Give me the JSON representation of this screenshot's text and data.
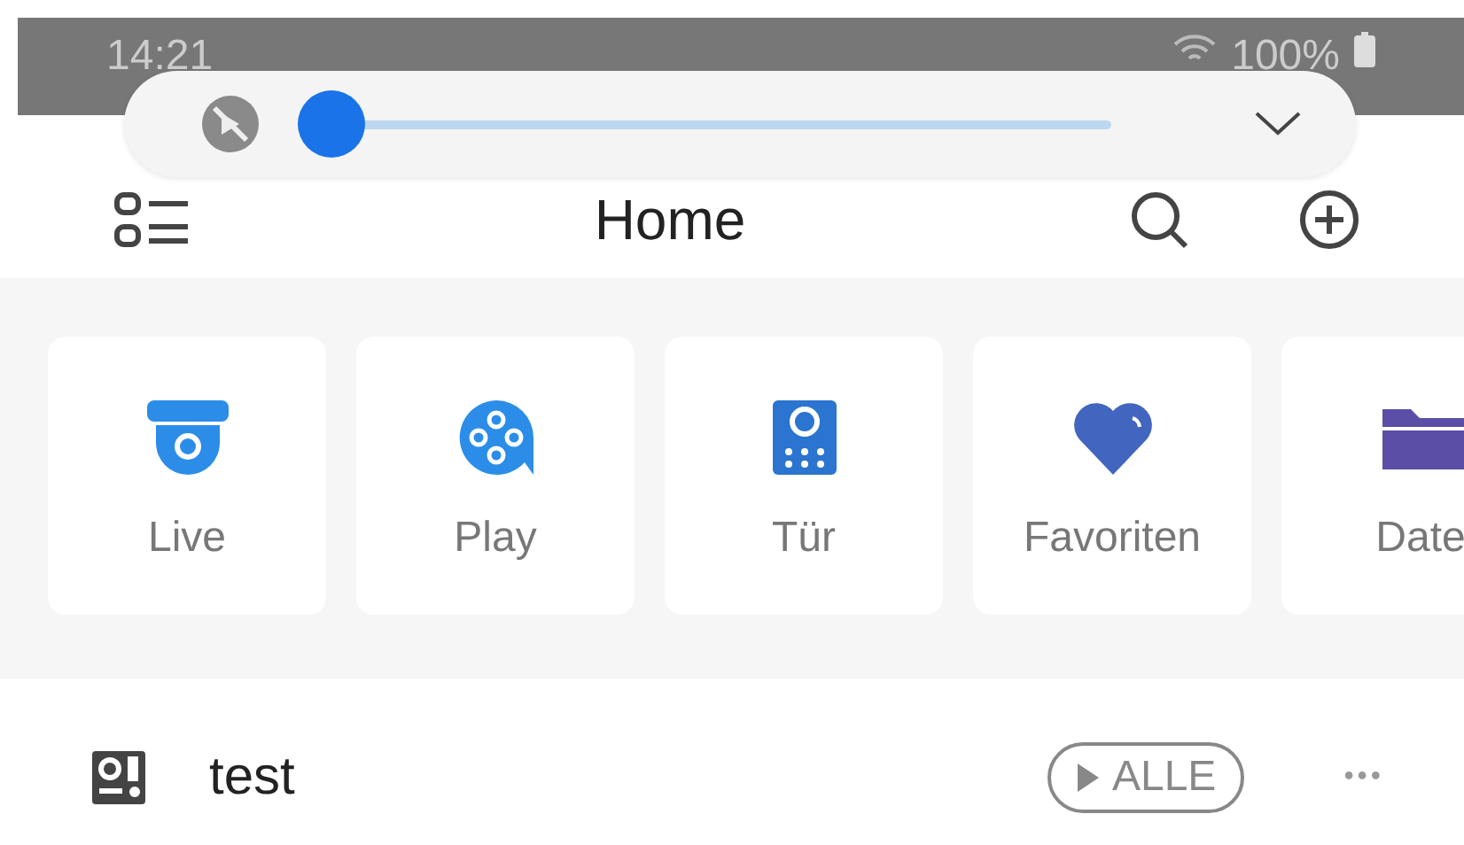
{
  "status_bar": {
    "time": "14:21",
    "battery": "100%"
  },
  "volume_panel": {
    "muted": true,
    "level": 0
  },
  "header": {
    "title": "Home"
  },
  "shortcuts": [
    {
      "kind": "camera",
      "label": "Live"
    },
    {
      "kind": "play",
      "label": "Play"
    },
    {
      "kind": "door",
      "label": "Tür"
    },
    {
      "kind": "heart",
      "label": "Favoriten"
    },
    {
      "kind": "folder",
      "label": "Date"
    }
  ],
  "device": {
    "name": "test",
    "button": "ALLE",
    "more": "•••"
  }
}
